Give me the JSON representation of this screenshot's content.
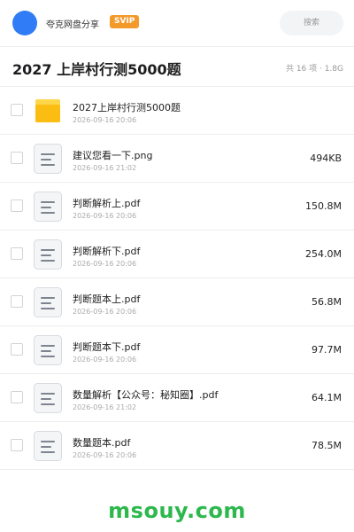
{
  "header": {
    "user_name": "夸克网盘分享",
    "badge": "SVIP",
    "search_placeholder": "搜索"
  },
  "folder": {
    "title": "2027 上岸村行测5000题",
    "meta": "共 16 项 · 1.8G"
  },
  "files": [
    {
      "name": "2027上岸村行测5000题",
      "date": "2026-09-16 20:06",
      "size": "",
      "icon": "folder-icon"
    },
    {
      "name": "建议您看一下.png",
      "date": "2026-09-16 21:02",
      "size": "494KB",
      "icon": "file-icon"
    },
    {
      "name": "判断解析上.pdf",
      "date": "2026-09-16 20:06",
      "size": "150.8M",
      "icon": "file-icon"
    },
    {
      "name": "判断解析下.pdf",
      "date": "2026-09-16 20:06",
      "size": "254.0M",
      "icon": "file-icon"
    },
    {
      "name": "判断题本上.pdf",
      "date": "2026-09-16 20:06",
      "size": "56.8M",
      "icon": "file-icon"
    },
    {
      "name": "判断题本下.pdf",
      "date": "2026-09-16 20:06",
      "size": "97.7M",
      "icon": "file-icon"
    },
    {
      "name": "数量解析【公众号：秘知圈】.pdf",
      "date": "2026-09-16 21:02",
      "size": "64.1M",
      "icon": "file-icon"
    },
    {
      "name": "数量题本.pdf",
      "date": "2026-09-16 20:06",
      "size": "78.5M",
      "icon": "file-icon"
    }
  ],
  "watermark": "msouy.com",
  "colors": {
    "avatar": "#2f7cf6",
    "badge": "#f39a2b",
    "folder": "#fbbd12",
    "watermark": "#2db84d"
  }
}
